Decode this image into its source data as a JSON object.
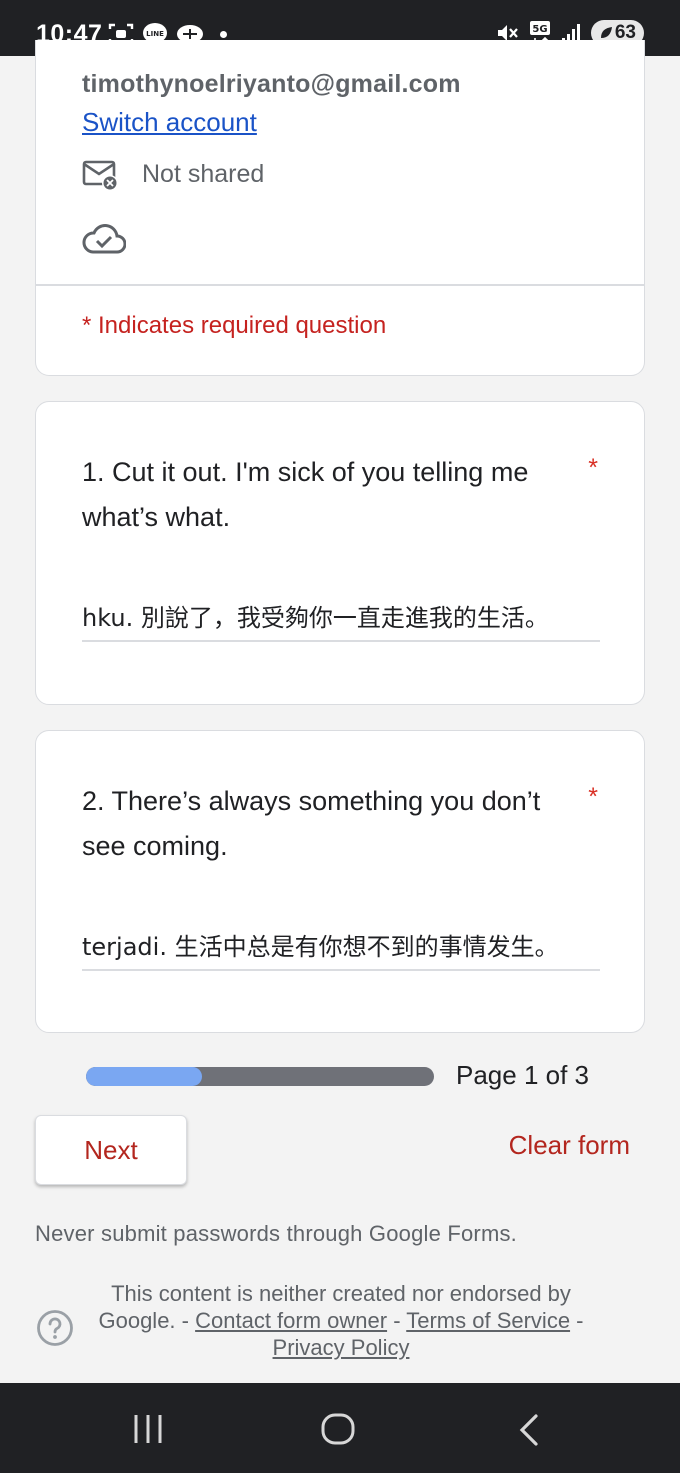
{
  "status_bar": {
    "time": "10:47",
    "battery": "63",
    "left_icons": [
      "scan-icon",
      "line-app-icon",
      "messaging-icon"
    ],
    "right_icons": [
      "mute-icon",
      "5g-icon",
      "signal-icon"
    ]
  },
  "account": {
    "email": "timothynoelriyanto@gmail.com",
    "switch_label": "Switch account",
    "not_shared_label": "Not shared",
    "required_note": "* Indicates required question"
  },
  "questions": [
    {
      "text": "1. Cut it out. I'm sick of you telling me what’s what.",
      "required_mark": "*",
      "answer": "hku. 別說了，我受夠你一直走進我的生活。"
    },
    {
      "text": "2.  There’s always something you don’t see coming.",
      "required_mark": "*",
      "answer": "terjadi. 生活中总是有你想不到的事情发生。"
    }
  ],
  "progress": {
    "label": "Page 1 of 3",
    "fraction": 0.333
  },
  "actions": {
    "next_label": "Next",
    "clear_label": "Clear form"
  },
  "footer": {
    "warning": "Never submit passwords through Google Forms.",
    "disclaimer": "This content is neither created nor endorsed by Google.",
    "sep1": " - ",
    "contact_label": "Contact form owner",
    "sep2": " - ",
    "terms_label": "Terms of Service",
    "sep3": " - ",
    "privacy_label": "Privacy Policy"
  },
  "colors": {
    "required": "#d93025",
    "action": "#b3261e",
    "link": "#1a53c7",
    "progress_fill": "#7aa7f2",
    "progress_track": "#6f7178"
  }
}
